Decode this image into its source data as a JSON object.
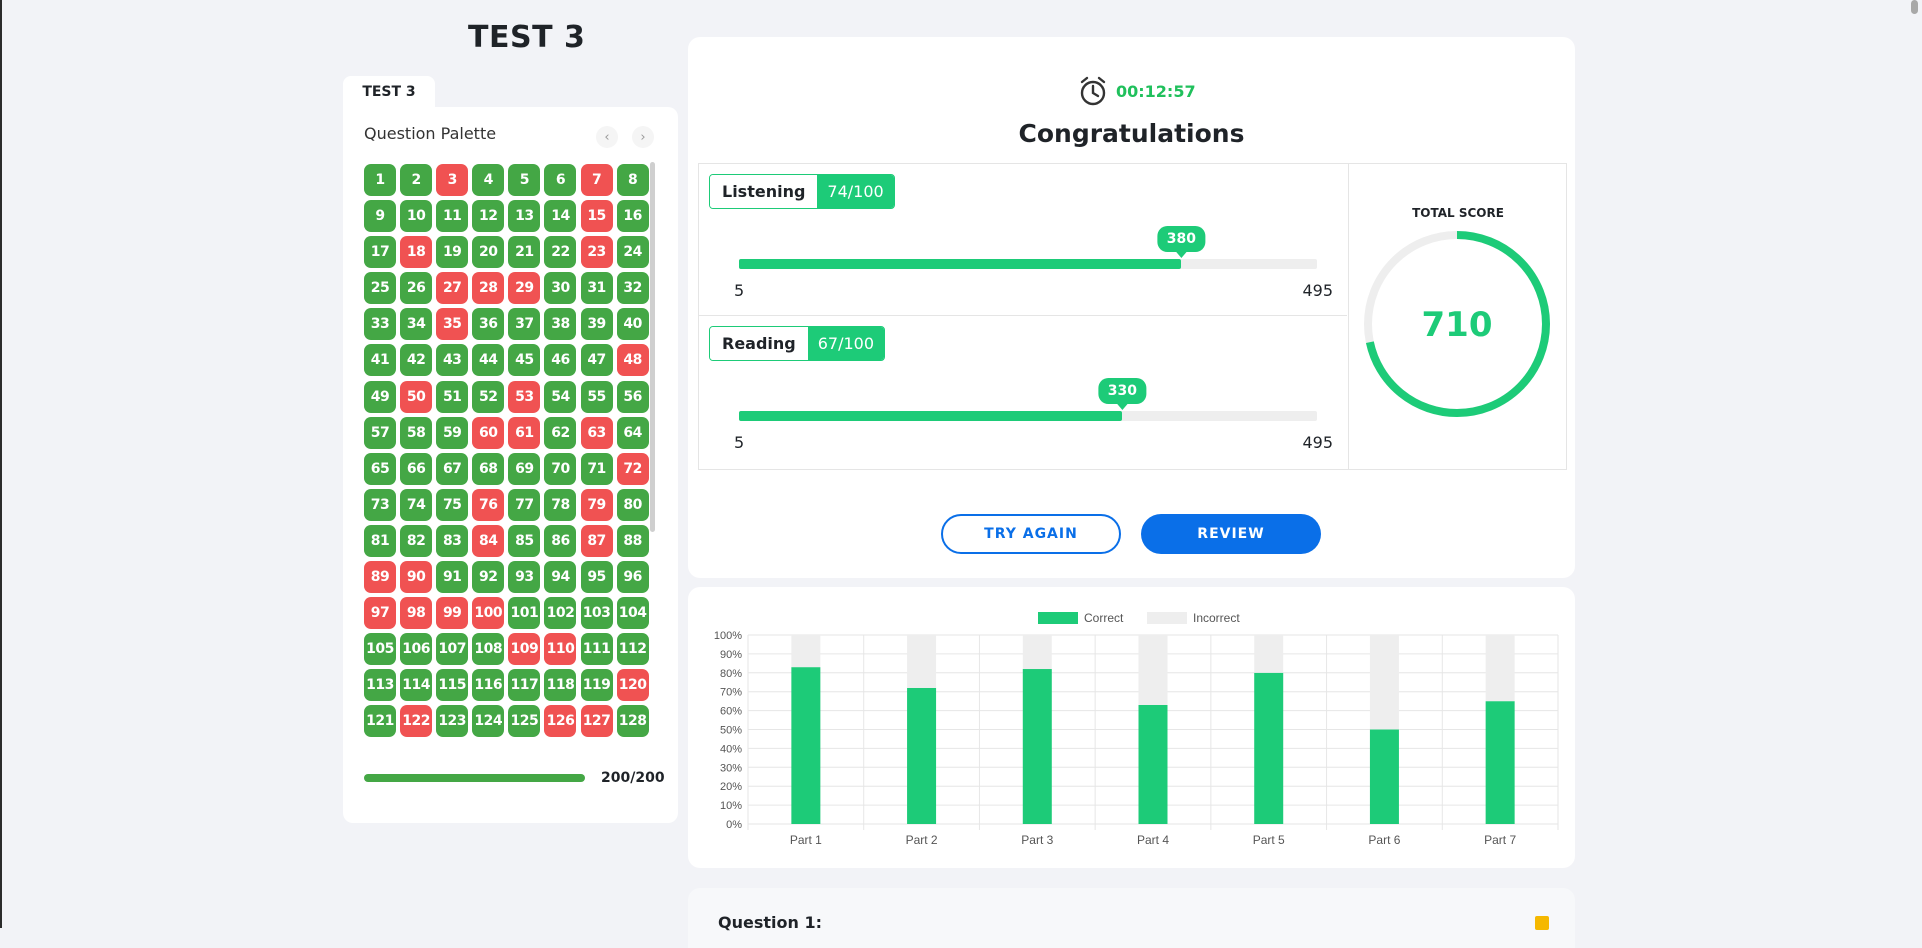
{
  "page_title": "TEST 3",
  "tab_label": "TEST 3",
  "palette": {
    "title": "Question Palette",
    "prev_icon": "‹",
    "next_icon": "›",
    "questions": [
      {
        "n": "1",
        "s": "correct"
      },
      {
        "n": "2",
        "s": "correct"
      },
      {
        "n": "3",
        "s": "incorrect"
      },
      {
        "n": "4",
        "s": "correct"
      },
      {
        "n": "5",
        "s": "correct"
      },
      {
        "n": "6",
        "s": "correct"
      },
      {
        "n": "7",
        "s": "incorrect"
      },
      {
        "n": "8",
        "s": "correct"
      },
      {
        "n": "9",
        "s": "correct"
      },
      {
        "n": "10",
        "s": "correct"
      },
      {
        "n": "11",
        "s": "correct"
      },
      {
        "n": "12",
        "s": "correct"
      },
      {
        "n": "13",
        "s": "correct"
      },
      {
        "n": "14",
        "s": "correct"
      },
      {
        "n": "15",
        "s": "incorrect"
      },
      {
        "n": "16",
        "s": "correct"
      },
      {
        "n": "17",
        "s": "correct"
      },
      {
        "n": "18",
        "s": "incorrect"
      },
      {
        "n": "19",
        "s": "correct"
      },
      {
        "n": "20",
        "s": "correct"
      },
      {
        "n": "21",
        "s": "correct"
      },
      {
        "n": "22",
        "s": "correct"
      },
      {
        "n": "23",
        "s": "incorrect"
      },
      {
        "n": "24",
        "s": "correct"
      },
      {
        "n": "25",
        "s": "correct"
      },
      {
        "n": "26",
        "s": "correct"
      },
      {
        "n": "27",
        "s": "incorrect"
      },
      {
        "n": "28",
        "s": "incorrect"
      },
      {
        "n": "29",
        "s": "incorrect"
      },
      {
        "n": "30",
        "s": "correct"
      },
      {
        "n": "31",
        "s": "correct"
      },
      {
        "n": "32",
        "s": "correct"
      },
      {
        "n": "33",
        "s": "correct"
      },
      {
        "n": "34",
        "s": "correct"
      },
      {
        "n": "35",
        "s": "incorrect"
      },
      {
        "n": "36",
        "s": "correct"
      },
      {
        "n": "37",
        "s": "correct"
      },
      {
        "n": "38",
        "s": "correct"
      },
      {
        "n": "39",
        "s": "correct"
      },
      {
        "n": "40",
        "s": "correct"
      },
      {
        "n": "41",
        "s": "correct"
      },
      {
        "n": "42",
        "s": "correct"
      },
      {
        "n": "43",
        "s": "correct"
      },
      {
        "n": "44",
        "s": "correct"
      },
      {
        "n": "45",
        "s": "correct"
      },
      {
        "n": "46",
        "s": "correct"
      },
      {
        "n": "47",
        "s": "correct"
      },
      {
        "n": "48",
        "s": "incorrect"
      },
      {
        "n": "49",
        "s": "correct"
      },
      {
        "n": "50",
        "s": "incorrect"
      },
      {
        "n": "51",
        "s": "correct"
      },
      {
        "n": "52",
        "s": "correct"
      },
      {
        "n": "53",
        "s": "incorrect"
      },
      {
        "n": "54",
        "s": "correct"
      },
      {
        "n": "55",
        "s": "correct"
      },
      {
        "n": "56",
        "s": "correct"
      },
      {
        "n": "57",
        "s": "correct"
      },
      {
        "n": "58",
        "s": "correct"
      },
      {
        "n": "59",
        "s": "correct"
      },
      {
        "n": "60",
        "s": "incorrect"
      },
      {
        "n": "61",
        "s": "incorrect"
      },
      {
        "n": "62",
        "s": "correct"
      },
      {
        "n": "63",
        "s": "incorrect"
      },
      {
        "n": "64",
        "s": "correct"
      },
      {
        "n": "65",
        "s": "correct"
      },
      {
        "n": "66",
        "s": "correct"
      },
      {
        "n": "67",
        "s": "correct"
      },
      {
        "n": "68",
        "s": "correct"
      },
      {
        "n": "69",
        "s": "correct"
      },
      {
        "n": "70",
        "s": "correct"
      },
      {
        "n": "71",
        "s": "correct"
      },
      {
        "n": "72",
        "s": "incorrect"
      },
      {
        "n": "73",
        "s": "correct"
      },
      {
        "n": "74",
        "s": "correct"
      },
      {
        "n": "75",
        "s": "correct"
      },
      {
        "n": "76",
        "s": "incorrect"
      },
      {
        "n": "77",
        "s": "correct"
      },
      {
        "n": "78",
        "s": "correct"
      },
      {
        "n": "79",
        "s": "incorrect"
      },
      {
        "n": "80",
        "s": "correct"
      },
      {
        "n": "81",
        "s": "correct"
      },
      {
        "n": "82",
        "s": "correct"
      },
      {
        "n": "83",
        "s": "correct"
      },
      {
        "n": "84",
        "s": "incorrect"
      },
      {
        "n": "85",
        "s": "correct"
      },
      {
        "n": "86",
        "s": "correct"
      },
      {
        "n": "87",
        "s": "incorrect"
      },
      {
        "n": "88",
        "s": "correct"
      },
      {
        "n": "89",
        "s": "incorrect"
      },
      {
        "n": "90",
        "s": "incorrect"
      },
      {
        "n": "91",
        "s": "correct"
      },
      {
        "n": "92",
        "s": "correct"
      },
      {
        "n": "93",
        "s": "correct"
      },
      {
        "n": "94",
        "s": "correct"
      },
      {
        "n": "95",
        "s": "correct"
      },
      {
        "n": "96",
        "s": "correct"
      },
      {
        "n": "97",
        "s": "incorrect"
      },
      {
        "n": "98",
        "s": "incorrect"
      },
      {
        "n": "99",
        "s": "incorrect"
      },
      {
        "n": "100",
        "s": "incorrect"
      },
      {
        "n": "101",
        "s": "correct"
      },
      {
        "n": "102",
        "s": "correct"
      },
      {
        "n": "103",
        "s": "correct"
      },
      {
        "n": "104",
        "s": "correct"
      },
      {
        "n": "105",
        "s": "correct"
      },
      {
        "n": "106",
        "s": "correct"
      },
      {
        "n": "107",
        "s": "correct"
      },
      {
        "n": "108",
        "s": "correct"
      },
      {
        "n": "109",
        "s": "incorrect"
      },
      {
        "n": "110",
        "s": "incorrect"
      },
      {
        "n": "111",
        "s": "correct"
      },
      {
        "n": "112",
        "s": "correct"
      },
      {
        "n": "113",
        "s": "correct"
      },
      {
        "n": "114",
        "s": "correct"
      },
      {
        "n": "115",
        "s": "correct"
      },
      {
        "n": "116",
        "s": "correct"
      },
      {
        "n": "117",
        "s": "correct"
      },
      {
        "n": "118",
        "s": "correct"
      },
      {
        "n": "119",
        "s": "correct"
      },
      {
        "n": "120",
        "s": "incorrect"
      },
      {
        "n": "121",
        "s": "correct"
      },
      {
        "n": "122",
        "s": "incorrect"
      },
      {
        "n": "123",
        "s": "correct"
      },
      {
        "n": "124",
        "s": "correct"
      },
      {
        "n": "125",
        "s": "correct"
      },
      {
        "n": "126",
        "s": "incorrect"
      },
      {
        "n": "127",
        "s": "incorrect"
      },
      {
        "n": "128",
        "s": "correct"
      }
    ],
    "progress_fraction": 1.0,
    "progress_text": "200/200"
  },
  "result": {
    "timer_icon": "alarm-clock-icon",
    "timer": "00:12:57",
    "heading": "Congratulations",
    "listening": {
      "label": "Listening",
      "value": "74/100",
      "score": "380",
      "score_num": 380,
      "min": "5",
      "max": "495"
    },
    "reading": {
      "label": "Reading",
      "value": "67/100",
      "score": "330",
      "score_num": 330,
      "min": "5",
      "max": "495"
    },
    "total_label": "TOTAL SCORE",
    "total_score": "710",
    "total_fraction": 0.717,
    "try_again": "TRY AGAIN",
    "review": "REVIEW"
  },
  "colors": {
    "correct": "#44a745",
    "incorrect": "#f05252",
    "accent": "#1dcb78",
    "primary_button": "#0a6fe8"
  },
  "chart_data": {
    "type": "bar",
    "stacked": true,
    "categories": [
      "Part 1",
      "Part 2",
      "Part 3",
      "Part 4",
      "Part 5",
      "Part 6",
      "Part 7"
    ],
    "series": [
      {
        "name": "Correct",
        "values": [
          83,
          72,
          82,
          63,
          80,
          50,
          65
        ],
        "color": "#1dcb78"
      },
      {
        "name": "Incorrect",
        "values": [
          17,
          28,
          18,
          37,
          20,
          50,
          35
        ],
        "color": "#eeeeee"
      }
    ],
    "ylim": [
      0,
      100
    ],
    "yticks": [
      "0%",
      "10%",
      "20%",
      "30%",
      "40%",
      "50%",
      "60%",
      "70%",
      "80%",
      "90%",
      "100%"
    ],
    "grid": true,
    "legend": "top-center"
  },
  "question": {
    "title": "Question 1:"
  }
}
